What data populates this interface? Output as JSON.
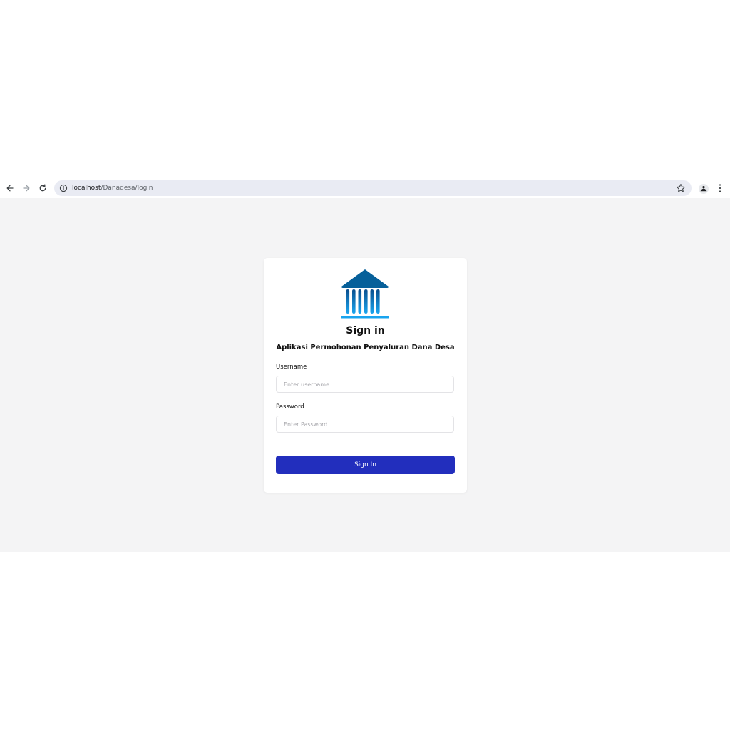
{
  "browser": {
    "url_host": "localhost",
    "url_path": "/Danadesa/login",
    "icons": {
      "back": "arrow-left-icon",
      "forward": "arrow-right-icon",
      "reload": "reload-icon",
      "site_info": "info-icon",
      "bookmark": "star-icon",
      "profile": "profile-icon",
      "menu": "kebab-menu-icon"
    }
  },
  "login": {
    "logo_icon": "bank-building-icon",
    "title": "Sign in",
    "subtitle": "Aplikasi Permohonan Penyaluran Dana Desa",
    "username_label": "Username",
    "username_placeholder": "Enter username",
    "password_label": "Password",
    "password_placeholder": "Enter Password",
    "submit_label": "Sign In"
  },
  "colors": {
    "page_background": "#f4f4f5",
    "button": "#222ebd",
    "logo_dark": "#06609a",
    "logo_light": "#18a4ef"
  }
}
